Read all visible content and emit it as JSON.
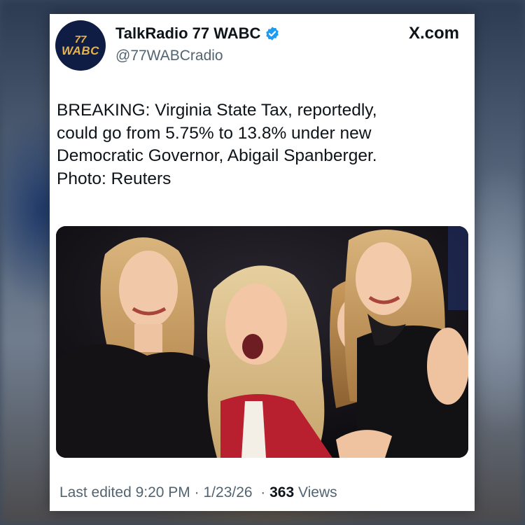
{
  "account": {
    "avatar_line1": "77",
    "avatar_line2": "WABC",
    "display_name": "TalkRadio 77 WABC",
    "handle": "@77WABCradio",
    "verified": true
  },
  "site_label": "X.com",
  "tweet": {
    "lines": [
      "BREAKING: Virginia State Tax, reportedly,",
      "could go from 5.75% to 13.8% under new",
      "Democratic Governor, Abigail Spanberger.",
      "Photo: Reuters"
    ]
  },
  "media": {
    "icon": "photo-of-four-women-celebrating"
  },
  "footer": {
    "edited_prefix": "Last edited",
    "time": "9:20 PM",
    "separator": "·",
    "date": "1/23/26",
    "views_count": "363",
    "views_label": "Views"
  },
  "colors": {
    "verified_blue": "#1d9bf0",
    "text_primary": "#0f1419",
    "text_secondary": "#536471",
    "avatar_bg": "#0f1d44",
    "avatar_text": "#e6b34a"
  }
}
